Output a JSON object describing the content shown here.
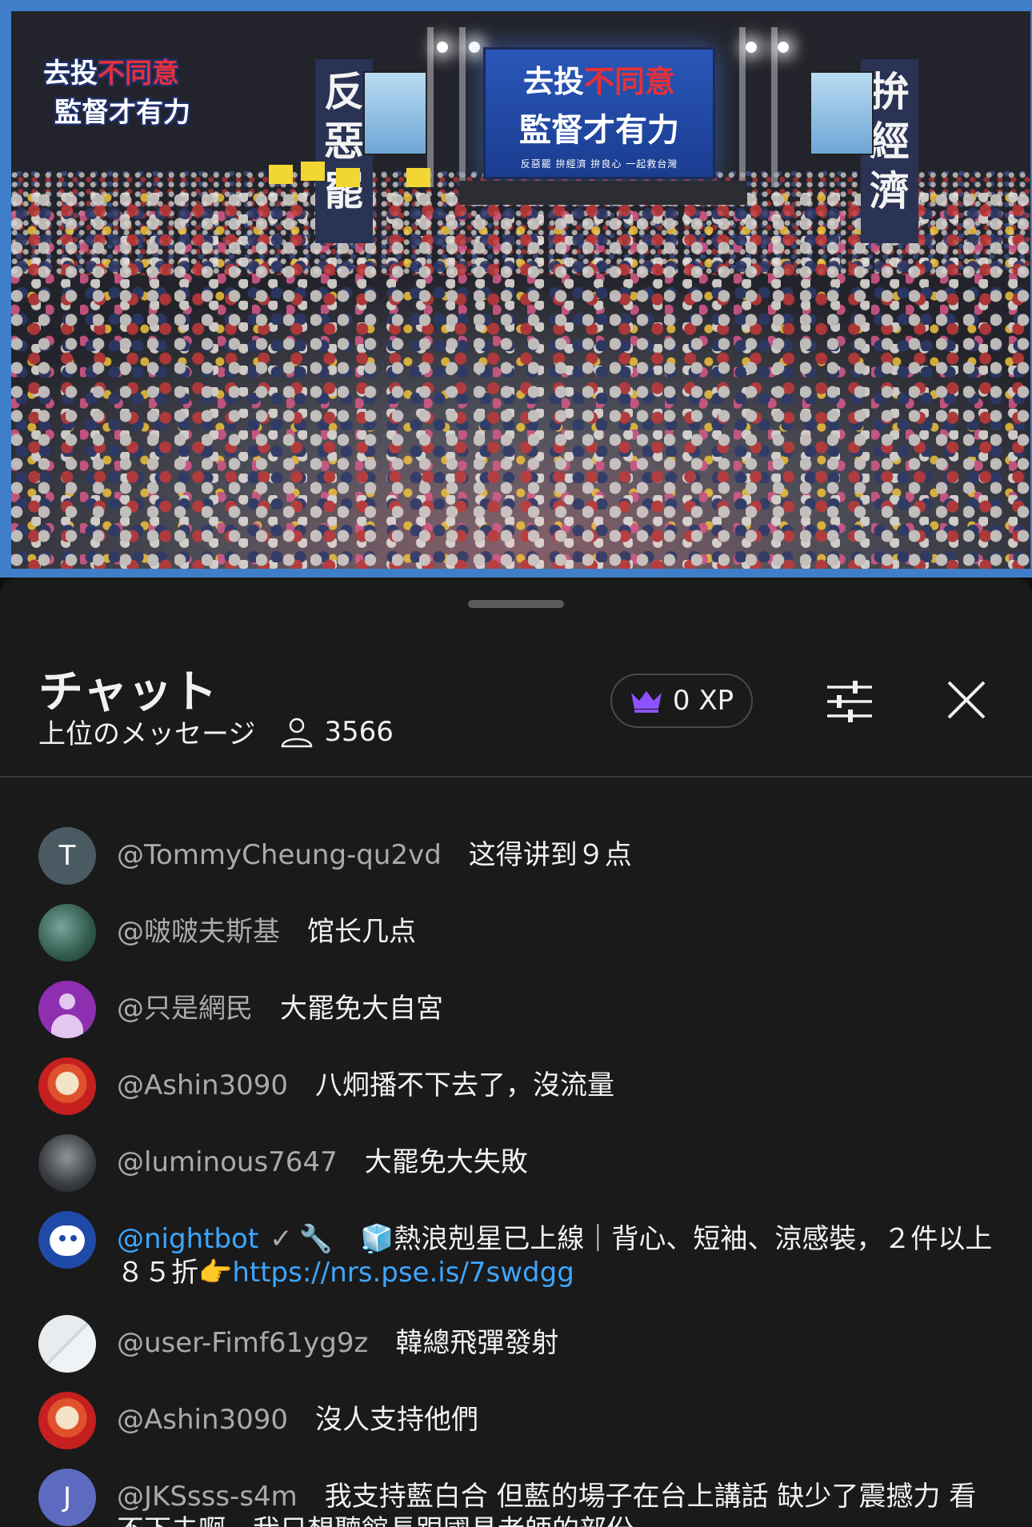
{
  "video": {
    "logo_line1_a": "去投",
    "logo_line1_b": "不同意",
    "logo_line2": "監督才有力",
    "screen_line1_a": "去投",
    "screen_line1_b": "不同意",
    "screen_line2": "監督才有力",
    "screen_line3": "反惡罷 拚經濟 拚良心 一起救台灣",
    "banner_left": [
      "反",
      "惡",
      "罷"
    ],
    "banner_right": [
      "拚",
      "經",
      "濟"
    ]
  },
  "chat": {
    "title": "チャット",
    "subtitle": "上位のメッセージ",
    "viewer_count": "3566",
    "xp_label": "0 XP",
    "colors": {
      "accent": "#3ea6ff",
      "crown": "#8c52ff",
      "background": "#1a1a1a"
    },
    "icons": {
      "viewers": "person-icon",
      "xp": "crown-icon",
      "filter": "tune-icon",
      "close": "close-icon"
    },
    "messages": [
      {
        "avatar_text": "T",
        "author": "@TommyCheung-qu2vd",
        "text": "这得讲到９点"
      },
      {
        "avatar_text": "",
        "author": "@啵啵夫斯基",
        "text": "馆长几点"
      },
      {
        "avatar_text": "",
        "author": "@只是網民",
        "text": "大罷免大自宮"
      },
      {
        "avatar_text": "",
        "author": "@Ashin3090",
        "text": "八炯播不下去了，沒流量"
      },
      {
        "avatar_text": "",
        "author": "@luminous7647",
        "text": "大罷免大失敗"
      },
      {
        "avatar_text": "",
        "author": "@nightbot",
        "badge": "✓",
        "wrench": "🔧",
        "text": "🧊熱浪剋星已上線｜背心、短袖、涼感裝，２件以上８５折👉",
        "link": "https://nrs.pse.is/7swdgg"
      },
      {
        "avatar_text": "",
        "author": "@user-Fimf61yg9z",
        "text": "韓總飛彈發射"
      },
      {
        "avatar_text": "",
        "author": "@Ashin3090",
        "text": "沒人支持他們"
      },
      {
        "avatar_text": "J",
        "author": "@JKSsss-s4m",
        "text": "我支持藍白合 但藍的場子在台上講話 缺少了震撼力 看不下去啊。我只想聽館長跟國昌老師的部份"
      }
    ]
  }
}
